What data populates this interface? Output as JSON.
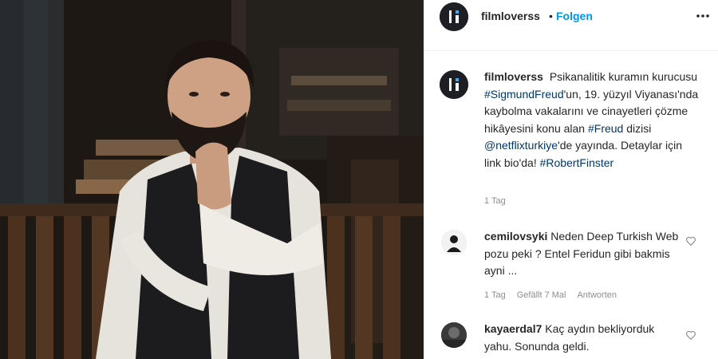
{
  "header": {
    "username": "filmloverss",
    "separator": "•",
    "follow_label": "Folgen"
  },
  "caption": {
    "username": "filmloverss",
    "text_1": "Psikanalitik kuramın kurucusu ",
    "tag_1": "#SigmundFreud",
    "text_2": "'un, 19. yüzyıl Viyanası'nda kaybolma vakalarını ve cinayetleri çözme hikâyesini konu alan ",
    "tag_2": "#Freud",
    "text_3": " dizisi ",
    "tag_3": "@netflixturkiye",
    "text_4": "'de yayında. Detaylar için link bio'da! ",
    "tag_4": "#RobertFinster",
    "time": "1 Tag"
  },
  "comments": [
    {
      "username": "cemilovsyki",
      "text": "Neden Deep Turkish Web pozu peki ? Entel Feridun gibi bakmis ayni ...",
      "time": "1 Tag",
      "likes": "Gefällt 7 Mal",
      "reply_label": "Antworten"
    },
    {
      "username": "kayaerdal7",
      "text": "Kaç aydın bekliyorduk yahu. Sonunda geldi."
    }
  ],
  "icons": {
    "more": "more-horizontal-icon",
    "heart": "heart-outline-icon"
  },
  "colors": {
    "follow": "#0095f6",
    "hashtag": "#00376b",
    "muted": "#8e8e8e"
  }
}
